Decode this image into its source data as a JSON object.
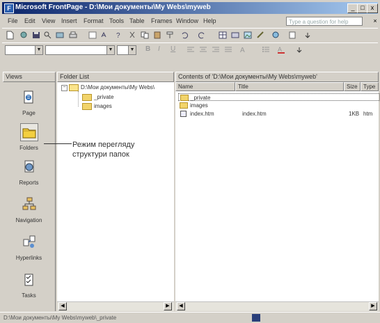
{
  "window": {
    "title": "Microsoft FrontPage - D:\\Мои документы\\My Webs\\myweb",
    "min_label": "_",
    "max_label": "□",
    "close_label": "x"
  },
  "menu": {
    "items": [
      "File",
      "Edit",
      "View",
      "Insert",
      "Format",
      "Tools",
      "Table",
      "Frames",
      "Window",
      "Help"
    ],
    "help_placeholder": "Type a question for help"
  },
  "panes": {
    "views_header": "Views",
    "folderlist_header": "Folder List",
    "contents_header": "Contents of 'D:\\Мои документы\\My Webs\\myweb'"
  },
  "views": [
    {
      "label": "Page",
      "icon": "page-view-icon"
    },
    {
      "label": "Folders",
      "icon": "folders-view-icon"
    },
    {
      "label": "Reports",
      "icon": "reports-view-icon"
    },
    {
      "label": "Navigation",
      "icon": "navigation-view-icon"
    },
    {
      "label": "Hyperlinks",
      "icon": "hyperlinks-view-icon"
    },
    {
      "label": "Tasks",
      "icon": "tasks-view-icon"
    }
  ],
  "tree": {
    "root": "D:\\Мои документы\\My Webs\\",
    "children": [
      "_private",
      "images"
    ]
  },
  "columns": [
    "Name",
    "Title",
    "Size",
    "Type"
  ],
  "files": [
    {
      "name": "_private",
      "title": "",
      "size": "",
      "type": ""
    },
    {
      "name": "images",
      "title": "",
      "size": "",
      "type": ""
    },
    {
      "name": "index.htm",
      "title": "index.htm",
      "size": "1KB",
      "type": "htm"
    }
  ],
  "annotation": "Режим перегляду\nструктури папок",
  "status": {
    "text": "D:\\Мои документы\\My Webs\\myweb\\_private"
  }
}
